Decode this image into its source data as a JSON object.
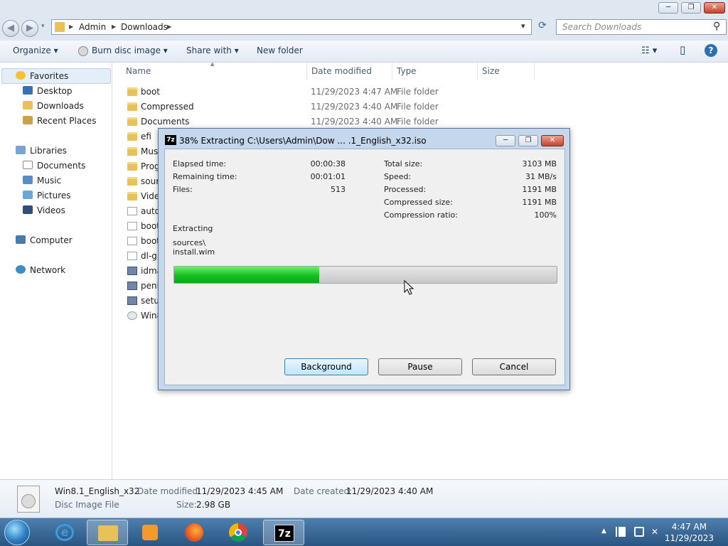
{
  "window": {
    "min_label": "─",
    "max_label": "❐",
    "close_label": "✕"
  },
  "address": {
    "back": "◀",
    "forward": "▶",
    "recent": "▾",
    "crumb_sep": "▶",
    "crumbs": [
      "Admin",
      "Downloads"
    ],
    "drop": "▾",
    "refresh": "⟳"
  },
  "search": {
    "placeholder": "Search Downloads",
    "icon": "⚲"
  },
  "toolbar": {
    "organize": "Organize ▾",
    "burn": "Burn disc image ▾",
    "share": "Share with ▾",
    "newfolder": "New folder",
    "views": "☷ ▾",
    "preview": "▯",
    "help": "?"
  },
  "sidebar": {
    "favorites": "Favorites",
    "desktop": "Desktop",
    "downloads": "Downloads",
    "recent": "Recent Places",
    "libraries": "Libraries",
    "documents": "Documents",
    "music": "Music",
    "pictures": "Pictures",
    "videos": "Videos",
    "computer": "Computer",
    "network": "Network"
  },
  "columns": {
    "name": "Name",
    "date": "Date modified",
    "type": "Type",
    "size": "Size",
    "sort_arrow": "▲"
  },
  "files": [
    {
      "name": "boot",
      "date": "11/29/2023 4:47 AM",
      "type": "File folder",
      "icon": "folder"
    },
    {
      "name": "Compressed",
      "date": "11/29/2023 4:40 AM",
      "type": "File folder",
      "icon": "folder"
    },
    {
      "name": "Documents",
      "date": "11/29/2023 4:40 AM",
      "type": "File folder",
      "icon": "folder"
    },
    {
      "name": "efi",
      "date": "",
      "type": "",
      "icon": "folder"
    },
    {
      "name": "Mus",
      "date": "",
      "type": "",
      "icon": "folder"
    },
    {
      "name": "Prog",
      "date": "",
      "type": "",
      "icon": "folder"
    },
    {
      "name": "sour",
      "date": "",
      "type": "",
      "icon": "folder"
    },
    {
      "name": "Vide",
      "date": "",
      "type": "",
      "icon": "folder"
    },
    {
      "name": "auto",
      "date": "",
      "type": "",
      "icon": "file"
    },
    {
      "name": "boot",
      "date": "",
      "type": "",
      "icon": "file"
    },
    {
      "name": "boot",
      "date": "",
      "type": "",
      "icon": "file"
    },
    {
      "name": "dl-g",
      "date": "",
      "type": "",
      "icon": "file"
    },
    {
      "name": "idma",
      "date": "",
      "type": "",
      "icon": "exe"
    },
    {
      "name": "peni",
      "date": "",
      "type": "",
      "icon": "exe"
    },
    {
      "name": "setu",
      "date": "",
      "type": "",
      "icon": "exe"
    },
    {
      "name": "Win8",
      "date": "",
      "type": "",
      "icon": "iso"
    }
  ],
  "dialog": {
    "title": "38% Extracting C:\\Users\\Admin\\Dow ... .1_English_x32.iso",
    "app_icon": "7z",
    "elapsed_label": "Elapsed time:",
    "elapsed": "00:00:38",
    "remaining_label": "Remaining time:",
    "remaining": "00:01:01",
    "files_label": "Files:",
    "files": "513",
    "total_label": "Total size:",
    "total": "3103 MB",
    "speed_label": "Speed:",
    "speed": "31 MB/s",
    "processed_label": "Processed:",
    "processed": "1191 MB",
    "compressed_label": "Compressed size:",
    "compressed": "1191 MB",
    "ratio_label": "Compression ratio:",
    "ratio": "100%",
    "extracting_label": "Extracting",
    "path_line1": "sources\\",
    "path_line2": "install.wim",
    "progress": 0.38,
    "background_btn": "Background",
    "pause_btn": "Pause",
    "cancel_btn": "Cancel"
  },
  "details": {
    "name": "Win8.1_English_x32",
    "kind": "Disc Image File",
    "modified_label": "Date modified:",
    "modified": "11/29/2023 4:45 AM",
    "created_label": "Date created:",
    "created": "11/29/2023 4:40 AM",
    "size_label": "Size:",
    "size": "2.98 GB"
  },
  "taskbar": {
    "time": "4:47 AM",
    "date": "11/29/2023",
    "tray_arrow": "▲",
    "sevenzip": "7z"
  },
  "colors": {
    "accent": "#2a5582",
    "progress": "#14c01e",
    "folder": "#e8c15a"
  }
}
